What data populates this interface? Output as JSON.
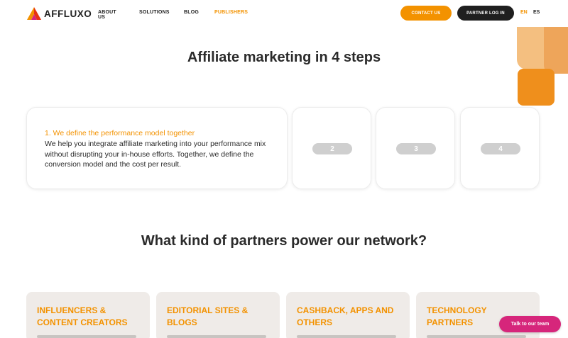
{
  "header": {
    "logo_text": "AFFLUXO",
    "nav": [
      {
        "label": "ABOUT US"
      },
      {
        "label": "SOLUTIONS"
      },
      {
        "label": "BLOG"
      },
      {
        "label": "PUBLISHERS"
      }
    ],
    "contact_label": "CONTACT US",
    "partner_login_label": "PARTNER LOG IN",
    "languages": [
      {
        "label": "EN",
        "active": true
      },
      {
        "label": "ES",
        "active": false
      }
    ]
  },
  "steps_section": {
    "title": "Affiliate marketing in 4 steps",
    "active_step": {
      "title": "1. We define the performance model together",
      "body": "We help you integrate affiliate marketing into your performance mix without disrupting your in-house efforts. Together, we define the conversion model and the cost per result."
    },
    "collapsed_steps": [
      {
        "label": "2"
      },
      {
        "label": "3"
      },
      {
        "label": "4"
      }
    ]
  },
  "partners_section": {
    "title": "What kind of partners power our network?",
    "cards": [
      {
        "title": "INFLUENCERS & CONTENT CREATORS"
      },
      {
        "title": "EDITORIAL SITES & BLOGS"
      },
      {
        "title": "CASHBACK, APPS AND OTHERS"
      },
      {
        "title": "TECHNOLOGY PARTNERS"
      }
    ]
  },
  "chat": {
    "label": "Talk to our team"
  },
  "colors": {
    "accent": "#f39200",
    "dark": "#1f1f1f",
    "chat": "#d6267b",
    "card_bg": "#efebe8"
  }
}
